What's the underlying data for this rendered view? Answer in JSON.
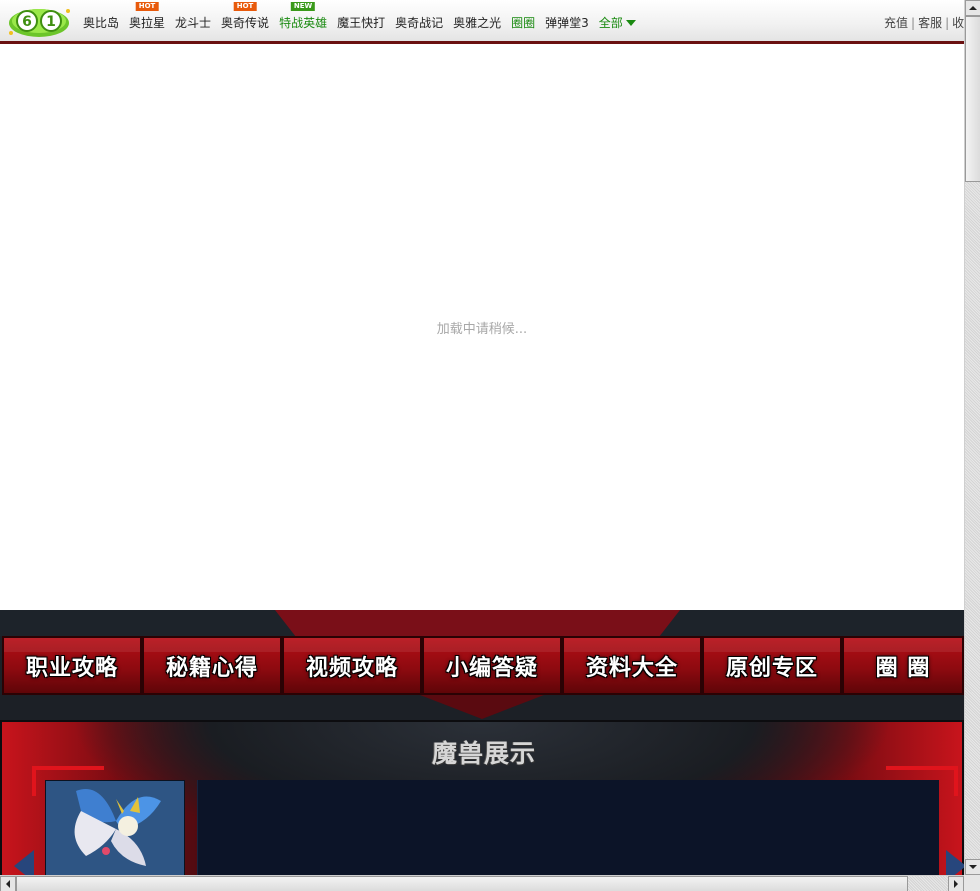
{
  "topbar": {
    "logo": "61-logo",
    "nav": [
      {
        "label": "奥比岛",
        "badge": "",
        "style": "normal"
      },
      {
        "label": "奥拉星",
        "badge": "HOT",
        "style": "normal"
      },
      {
        "label": "龙斗士",
        "badge": "",
        "style": "normal"
      },
      {
        "label": "奥奇传说",
        "badge": "HOT",
        "style": "normal"
      },
      {
        "label": "特战英雄",
        "badge": "NEW",
        "style": "green"
      },
      {
        "label": "魔王快打",
        "badge": "",
        "style": "normal"
      },
      {
        "label": "奥奇战记",
        "badge": "",
        "style": "normal"
      },
      {
        "label": "奥雅之光",
        "badge": "",
        "style": "normal"
      },
      {
        "label": "圈圈",
        "badge": "",
        "style": "green"
      },
      {
        "label": "弹弹堂3",
        "badge": "",
        "style": "normal"
      }
    ],
    "all_label": "全部",
    "right_links": [
      "充值",
      "客服",
      "收"
    ]
  },
  "loading_text": "加载中请稍候...",
  "game": {
    "menu": [
      "职业攻略",
      "秘籍心得",
      "视频攻略",
      "小编答疑",
      "资料大全",
      "原创专区",
      "圈 圈"
    ],
    "showcase_title": "魔兽展示"
  },
  "colors": {
    "nav_green": "#1a8a11",
    "badge_hot": "#e85a0c",
    "badge_new": "#3a9a1a",
    "menu_red": "#b50f16",
    "frame_red": "#e0141c"
  }
}
